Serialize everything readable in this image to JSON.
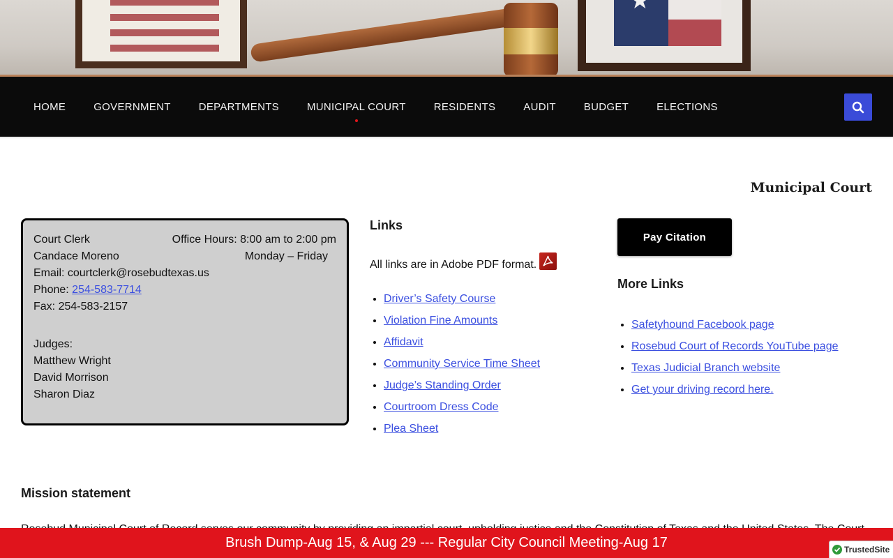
{
  "nav": {
    "items": [
      {
        "label": "HOME"
      },
      {
        "label": "GOVERNMENT"
      },
      {
        "label": "DEPARTMENTS"
      },
      {
        "label": "MUNICIPAL COURT",
        "active": true
      },
      {
        "label": "RESIDENTS"
      },
      {
        "label": "AUDIT"
      },
      {
        "label": "BUDGET"
      },
      {
        "label": "ELECTIONS"
      }
    ],
    "search_icon": "search-icon",
    "accent_color": "#3a4bd8"
  },
  "page": {
    "title": "Municipal Court"
  },
  "clerk": {
    "role": "Court Clerk",
    "name": "Candace Moreno",
    "hours": "Office Hours: 8:00 am to 2:00 pm",
    "days": "Monday – Friday",
    "email": "Email: courtclerk@rosebudtexas.us",
    "phone_label": "Phone: ",
    "phone": "254-583-7714",
    "fax": "Fax: 254-583-2157",
    "judges_label": "Judges:",
    "judges": [
      "Matthew Wright",
      "David Morrison",
      "Sharon Diaz"
    ]
  },
  "links": {
    "heading": "Links",
    "pdf_note": "All links are in Adobe PDF format.",
    "pdf_icon": "pdf-icon",
    "items": [
      "Driver’s Safety Course",
      "Violation Fine Amounts",
      "Affidavit",
      "Community Service Time Sheet",
      "Judge’s Standing Order",
      "Courtroom Dress Code",
      "Plea Sheet"
    ]
  },
  "more": {
    "pay_button": "Pay Citation",
    "heading": "More Links",
    "items": [
      "Safetyhound Facebook page",
      "Rosebud Court of Records YouTube page",
      "Texas Judicial Branch website",
      "Get your driving record here."
    ]
  },
  "mission": {
    "heading": "Mission statement",
    "text": "Rosebud Municipal Court of Record serves our community by providing an impartial court, upholding justice and the Constitution of Texas and the United States. The Court"
  },
  "announcement": {
    "text": "Brush Dump-Aug 15, & Aug 29 --- Regular City Council Meeting-Aug 17",
    "color": "#e0141c"
  },
  "badge": {
    "label": "TrustedSite",
    "icon": "check-icon"
  }
}
